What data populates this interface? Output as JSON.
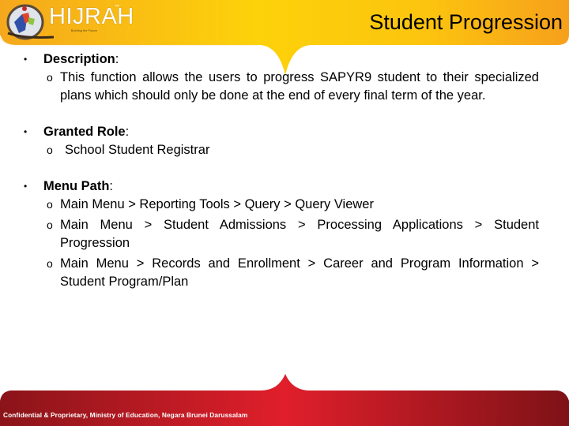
{
  "header": {
    "logo": {
      "icon": "hijrah-emblem-icon",
      "wordmark": "HIJRAH",
      "trademark": "™",
      "tagline": "Building the Future"
    },
    "title": "Student Progression",
    "colors": {
      "band_start": "#f5a81c",
      "band_mid": "#fdd20a",
      "band_end": "#f7a21b"
    }
  },
  "sections": [
    {
      "heading": "Description",
      "colon": ":",
      "items": [
        "This function allows the users to progress SAPYR9 student to their specialized plans which should only be done at the end of every final term of the year."
      ]
    },
    {
      "heading": "Granted Role",
      "colon": ":",
      "items": [
        "School Student Registrar"
      ]
    },
    {
      "heading": "Menu Path",
      "colon": ":",
      "items": [
        "Main Menu > Reporting Tools > Query > Query Viewer",
        "Main Menu > Student Admissions > Processing Applications > Student Progression",
        "Main Menu > Records and Enrollment > Career and Program Information > Student Program/Plan"
      ]
    }
  ],
  "bullets": {
    "primary": "•",
    "secondary": "o"
  },
  "footer": {
    "text": "Confidential & Proprietary, Ministry of Education, Negara Brunei Darussalam",
    "colors": {
      "band_edge": "#8a1419",
      "band_center": "#e01f2b"
    }
  }
}
